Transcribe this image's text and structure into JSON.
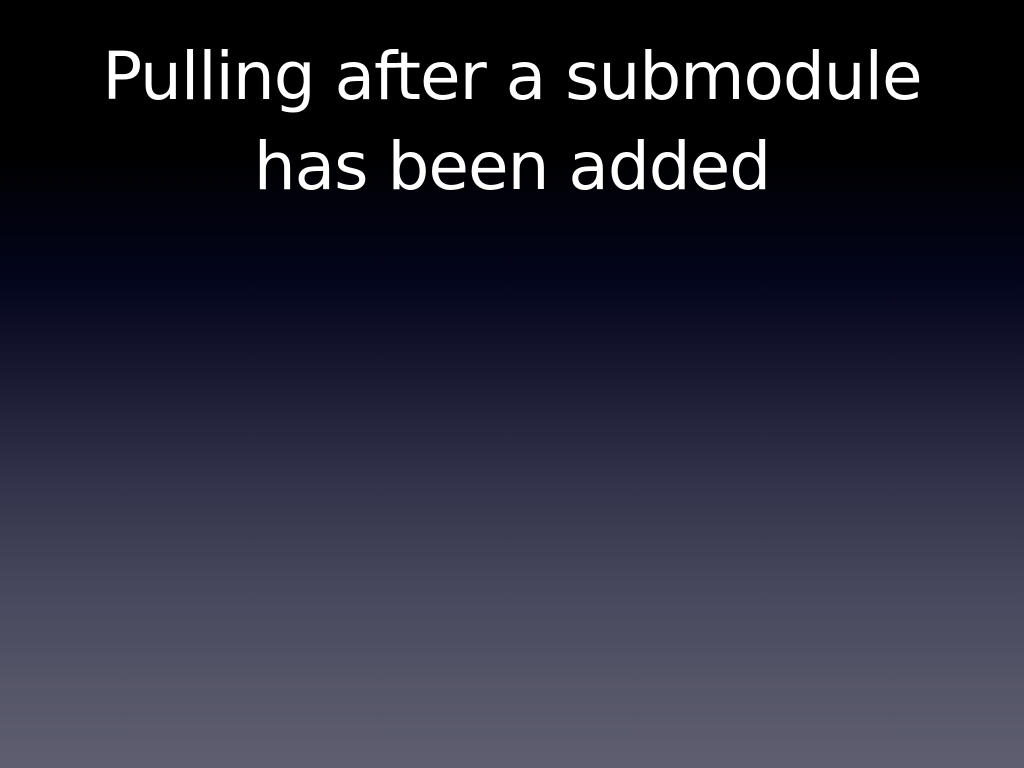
{
  "slide": {
    "title_lines": [
      "Pulling after a submodule",
      "has been added"
    ],
    "colors": {
      "text": "#ffffff",
      "background_top": "#000000",
      "background_bottom": "#5e5e70"
    }
  }
}
